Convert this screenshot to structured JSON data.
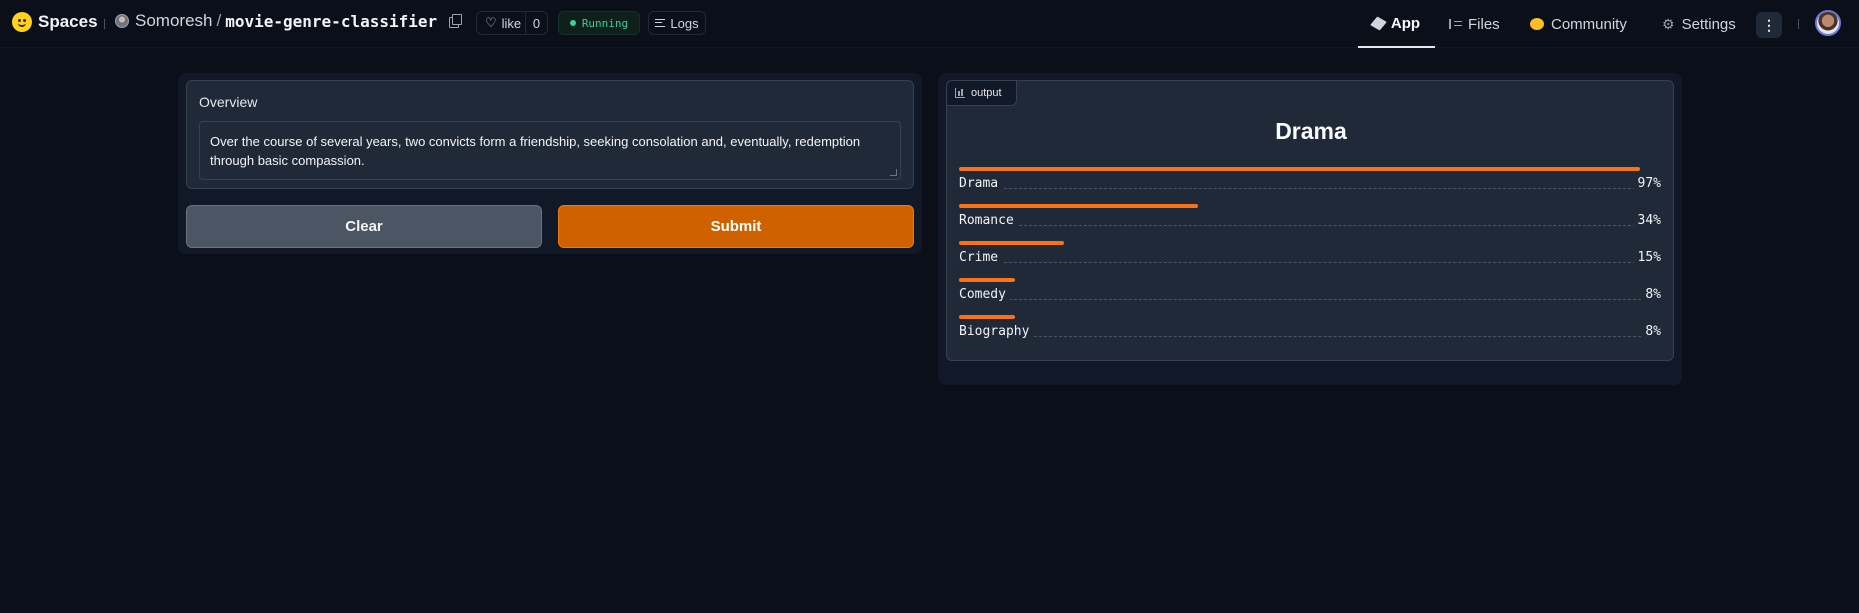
{
  "header": {
    "brand": "Spaces",
    "owner": "Somoresh",
    "separator": "/",
    "repo": "movie-genre-classifier",
    "like_label": "like",
    "like_count": "0",
    "status": "Running",
    "logs_label": "Logs",
    "nav": {
      "app": "App",
      "files": "Files",
      "community": "Community",
      "settings": "Settings"
    },
    "menu_glyph": "⋮"
  },
  "input": {
    "label": "Overview",
    "value": "Over the course of several years, two convicts form a friendship, seeking consolation and, eventually, redemption through basic compassion."
  },
  "buttons": {
    "clear": "Clear",
    "submit": "Submit"
  },
  "output": {
    "tag": "output",
    "top_label": "Drama",
    "confidences": [
      {
        "label": "Drama",
        "value": 0.97,
        "display": "97%"
      },
      {
        "label": "Romance",
        "value": 0.34,
        "display": "34%"
      },
      {
        "label": "Crime",
        "value": 0.15,
        "display": "15%"
      },
      {
        "label": "Comedy",
        "value": 0.08,
        "display": "8%"
      },
      {
        "label": "Biography",
        "value": 0.08,
        "display": "8%"
      }
    ]
  },
  "colors": {
    "accent": "#d06100",
    "bar": "#f97316",
    "status": "#34d399",
    "background": "#0b0f19"
  }
}
